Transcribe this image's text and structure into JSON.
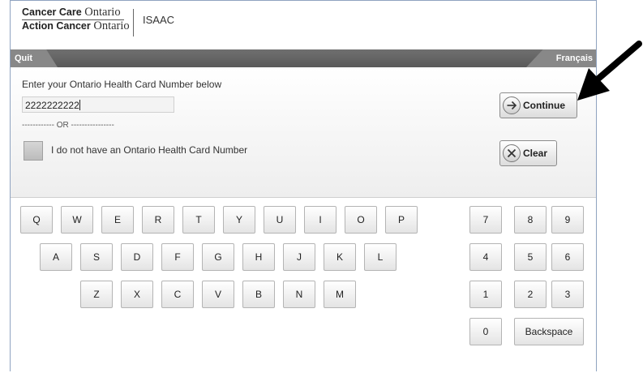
{
  "header": {
    "logo_line1_bold": "Cancer Care",
    "logo_line1": "Ontario",
    "logo_line2_bold": "Action Cancer",
    "logo_line2": "Ontario",
    "app_name": "ISAAC"
  },
  "topbar": {
    "quit_label": "Quit",
    "language_label": "Français"
  },
  "form": {
    "prompt": "Enter your Ontario Health Card Number below",
    "health_card_value": "2222222222",
    "or_text": "------------ OR ----------------",
    "no_card_label": "I do not have an Ontario Health Card Number",
    "no_card_checked": false,
    "continue_label": "Continue",
    "clear_label": "Clear"
  },
  "keyboard": {
    "row1": [
      "Q",
      "W",
      "E",
      "R",
      "T",
      "Y",
      "U",
      "I",
      "O",
      "P"
    ],
    "row2": [
      "A",
      "S",
      "D",
      "F",
      "G",
      "H",
      "J",
      "K",
      "L"
    ],
    "row3": [
      "Z",
      "X",
      "C",
      "V",
      "B",
      "N",
      "M"
    ],
    "numpad": {
      "row1": [
        "7",
        "8",
        "9"
      ],
      "row2": [
        "4",
        "5",
        "6"
      ],
      "row3": [
        "1",
        "2",
        "3"
      ],
      "zero": "0",
      "backspace": "Backspace"
    }
  },
  "icons": {
    "continue": "arrow-right-circle-icon",
    "clear": "x-circle-icon",
    "pointer": "annotation-arrow-icon"
  },
  "colors": {
    "topbar": "#5f5f5f",
    "tab": "#888888",
    "frame_border": "#8fa3c0",
    "annotation_arrow": "#000000"
  }
}
